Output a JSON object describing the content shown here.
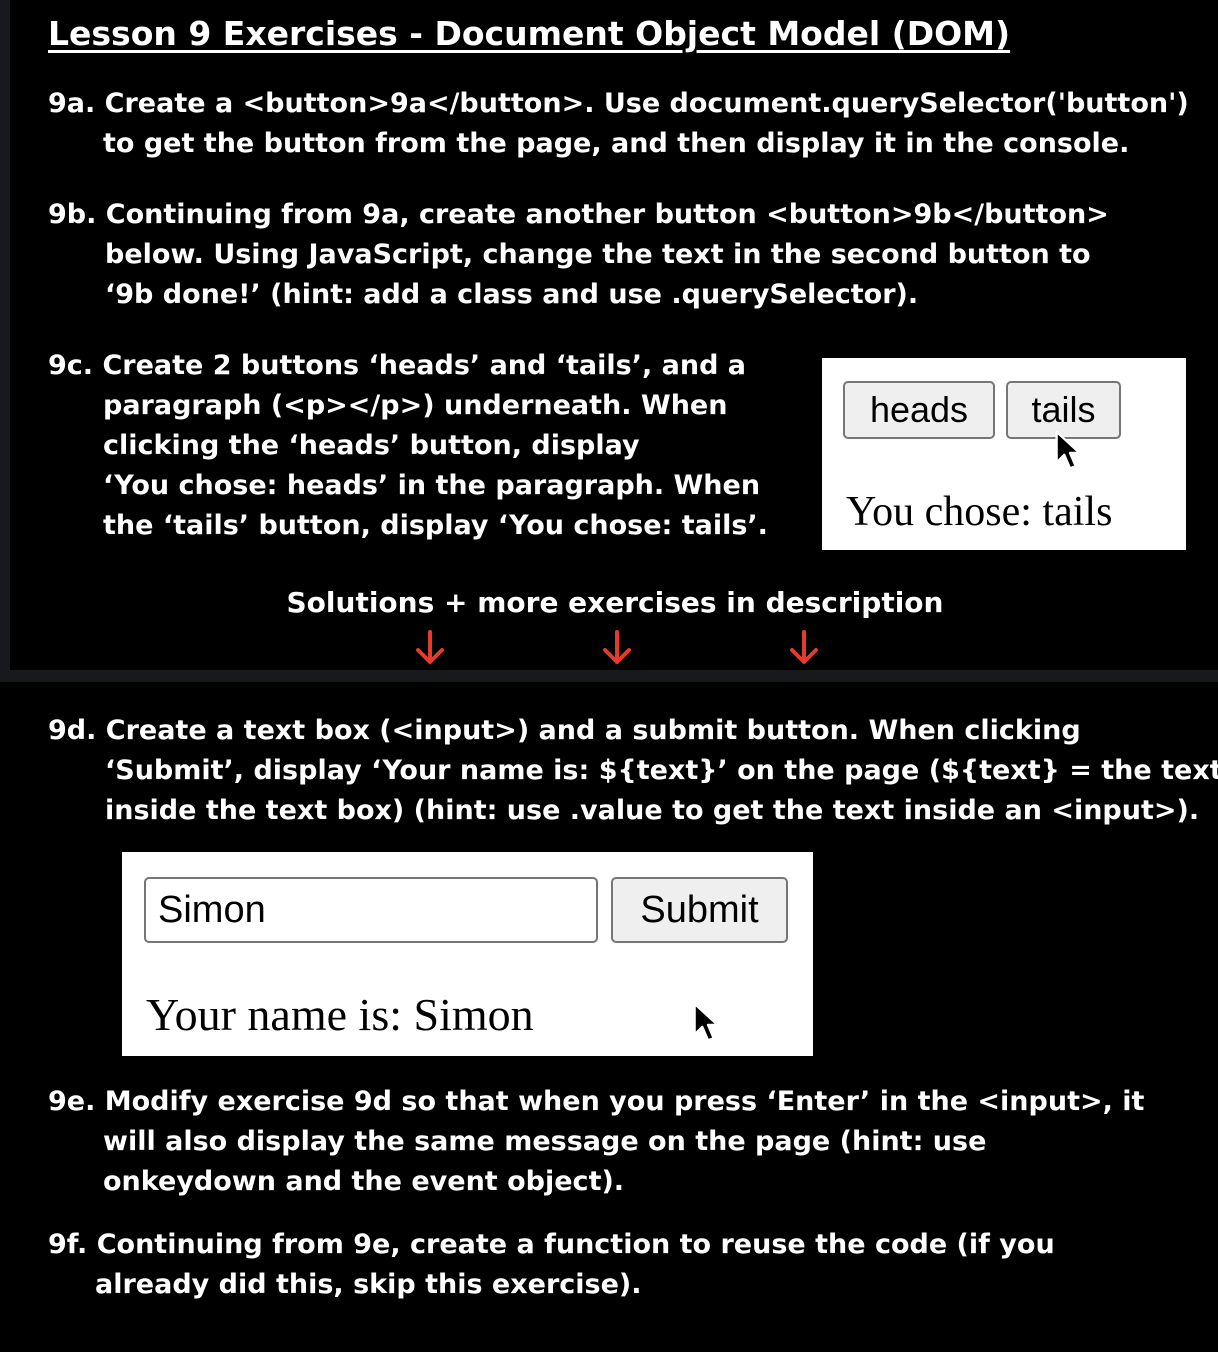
{
  "title": "Lesson 9 Exercises - Document Object Model (DOM)",
  "exercises": {
    "e9a": {
      "lines": [
        "9a. Create a <button>9a</button>. Use document.querySelector('button')",
        "to get the button from the page, and then display it in the console."
      ]
    },
    "e9b": {
      "lines": [
        "9b. Continuing from 9a, create another button <button>9b</button>",
        "below. Using JavaScript, change the text in the second button to",
        "‘9b done!’ (hint: add a class and use .querySelector)."
      ]
    },
    "e9c": {
      "lines": [
        "9c. Create 2 buttons ‘heads’ and ‘tails’, and a",
        "paragraph (<p></p>) underneath. When",
        "clicking the ‘heads’ button, display",
        "‘You chose: heads’ in the paragraph. When",
        "the ‘tails’ button, display ‘You chose: tails’."
      ]
    },
    "e9d": {
      "lines": [
        "9d. Create a text box (<input>) and a submit button. When clicking",
        "‘Submit’, display ‘Your name is: ${text}’ on the page (${text} = the text",
        "inside the text box) (hint: use .value to get the text inside an <input>)."
      ]
    },
    "e9e": {
      "lines": [
        "9e. Modify exercise 9d so that when you press ‘Enter’ in the <input>, it",
        "will also display the same message on the page (hint: use",
        "onkeydown and the event object)."
      ]
    },
    "e9f": {
      "lines": [
        "9f. Continuing from 9e, create a function to reuse the code (if you",
        "already did this, skip this exercise)."
      ]
    }
  },
  "demo_coin": {
    "heads_label": "heads",
    "tails_label": "tails",
    "result": "You chose: tails"
  },
  "solutions_text": "Solutions + more exercises in description",
  "demo_name": {
    "input_value": "Simon",
    "submit_label": "Submit",
    "result": "Your name is: Simon"
  },
  "colors": {
    "background": "#000000",
    "text": "#ffffff",
    "arrow": "#e53b2c",
    "divider": "#17191d"
  },
  "icons": [
    "cursor-arrow-icon",
    "down-arrow-icon"
  ]
}
